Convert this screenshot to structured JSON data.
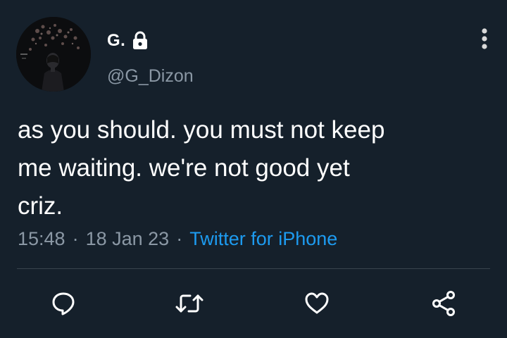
{
  "author": {
    "display_name": "G.",
    "handle": "@G_Dizon",
    "avatar_icon": "profile-photo",
    "protected_icon": "lock-icon"
  },
  "tweet": {
    "text": "as you should. you must not keep\nme waiting. we're not good yet\ncriz.",
    "time": "15:48",
    "date": "18 Jan 23",
    "separator": "·",
    "source": "Twitter for iPhone"
  },
  "menu": {
    "icon": "more-vertical-icon"
  },
  "actions": [
    {
      "name": "reply",
      "icon": "reply-icon"
    },
    {
      "name": "retweet",
      "icon": "retweet-icon"
    },
    {
      "name": "like",
      "icon": "heart-icon"
    },
    {
      "name": "share",
      "icon": "share-icon"
    }
  ],
  "colors": {
    "background": "#15202b",
    "text_primary": "#ffffff",
    "text_secondary": "#8b98a5",
    "link": "#1d9bf0",
    "divider": "#38444d"
  }
}
